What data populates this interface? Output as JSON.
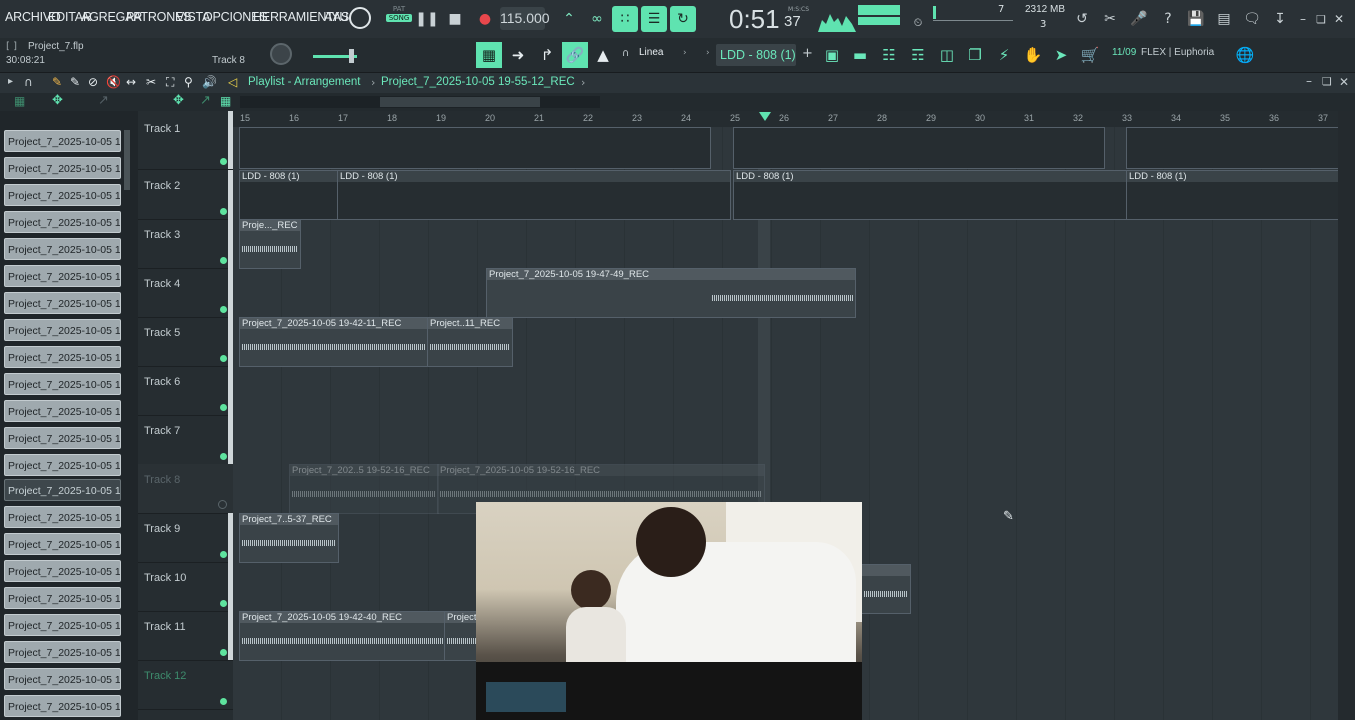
{
  "menubar": {
    "items": [
      "ARCHIVO",
      "EDITAR",
      "AGREGAR",
      "PATRONES",
      "VISTA",
      "OPCIONES",
      "HERRAMIENTAS",
      "AYU"
    ],
    "pat_label": "PAT",
    "song_label": "SONG",
    "tempo": "115.000",
    "time": "0:51",
    "time_sub": "37",
    "time_unit": "M:S:CS",
    "cpu_value": "7",
    "memory": "2312 MB",
    "voices": "3"
  },
  "toolbar2": {
    "project_file": "Project_7.flp",
    "elapsed": "30:08:21",
    "track_hint": "Track 8",
    "snap_label": "Linea",
    "pattern_selector": "LDD - 808 (1)",
    "plugin_date": "11/09",
    "plugin_name": "FLEX | Euphoria"
  },
  "playlist": {
    "title": "Playlist - Arrangement",
    "breadcrumb": "Project_7_2025-10-05 19-55-12_REC"
  },
  "browser": {
    "patterns": [
      "Project_7_2025-10-05 19...",
      "Project_7_2025-10-05 19...",
      "Project_7_2025-10-05 19...",
      "Project_7_2025-10-05 19...",
      "Project_7_2025-10-05 19...",
      "Project_7_2025-10-05 19...",
      "Project_7_2025-10-05 19...",
      "Project_7_2025-10-05 19...",
      "Project_7_2025-10-05 19...",
      "Project_7_2025-10-05 19...",
      "Project_7_2025-10-05 19...",
      "Project_7_2025-10-05 19...",
      "Project_7_2025-10-05 19...",
      "Project_7_2025-10-05 19...",
      "Project_7_2025-10-05 19...",
      "Project_7_2025-10-05 19...",
      "Project_7_2025-10-05 19...",
      "Project_7_2025-10-05 19...",
      "Project_7_2025-10-05 19...",
      "Project_7_2025-10-05 19...",
      "Project_7_2025-10-05 19...",
      "Project_7_2025-10-05 19..."
    ]
  },
  "tracks": [
    "Track 1",
    "Track 2",
    "Track 3",
    "Track 4",
    "Track 5",
    "Track 6",
    "Track 7",
    "Track 8",
    "Track 9",
    "Track 10",
    "Track 11",
    "Track 12"
  ],
  "ruler": [
    "15",
    "16",
    "17",
    "18",
    "19",
    "20",
    "21",
    "22",
    "23",
    "24",
    "25",
    "26",
    "27",
    "28",
    "29",
    "30",
    "31",
    "32",
    "33",
    "34",
    "35",
    "36",
    "37"
  ],
  "clips": {
    "t2a": "LDD - 808 (1)",
    "t2b": "LDD - 808 (1)",
    "t2c": "LDD - 808 (1)",
    "t2d": "LDD - 808 (1)",
    "t3": "Proje..._REC",
    "t4": "Project_7_2025-10-05 19-47-49_REC",
    "t5a": "Project_7_2025-10-05 19-42-11_REC",
    "t5b": "Project..11_REC",
    "t8a": "Project_7_202..5 19-52-16_REC",
    "t8b": "Project_7_2025-10-05 19-52-16_REC",
    "t9": "Project_7..5-37_REC",
    "t11a": "Project_7_2025-10-05 19-42-40_REC",
    "t11b": "Project"
  }
}
